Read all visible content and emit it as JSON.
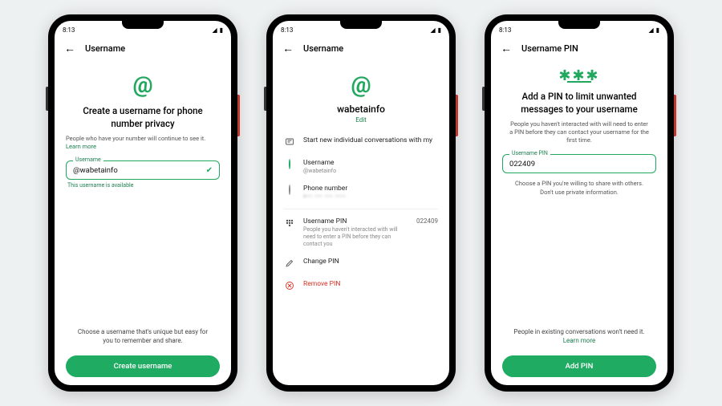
{
  "status": {
    "time": "8:13"
  },
  "screen1": {
    "appbar_title": "Username",
    "heading": "Create a username for phone number privacy",
    "subtext": "People who have your number will continue to see it.",
    "learn_more": "Learn more",
    "field_label": "Username",
    "field_value": "@wabetainfo",
    "hint": "This username is available",
    "note": "Choose a username that's unique but easy for you to remember and share.",
    "cta": "Create username"
  },
  "screen2": {
    "appbar_title": "Username",
    "username": "wabetainfo",
    "edit": "Edit",
    "section_title": "Start new individual conversations with my",
    "option_username_title": "Username",
    "option_username_sub": "@wabetainfo",
    "option_phone_title": "Phone number",
    "option_phone_sub": "+•• ••• ••• ••••",
    "pin_row_title": "Username PIN",
    "pin_row_desc": "People you haven't interacted with will need to enter a PIN before they can contact you",
    "pin_value": "022409",
    "change_pin": "Change PIN",
    "remove_pin": "Remove PIN"
  },
  "screen3": {
    "appbar_title": "Username PIN",
    "heading": "Add a PIN to limit unwanted messages to your username",
    "subtext": "People you haven't interacted with will need to enter a PIN before they can contact your username for the first time.",
    "field_label": "Username PIN",
    "field_value": "022409",
    "choose_note": "Choose a PIN you're willing to share with others. Don't use private information.",
    "footer_note": "People in existing conversations won't need it.",
    "learn_more": "Learn more",
    "cta": "Add PIN"
  }
}
